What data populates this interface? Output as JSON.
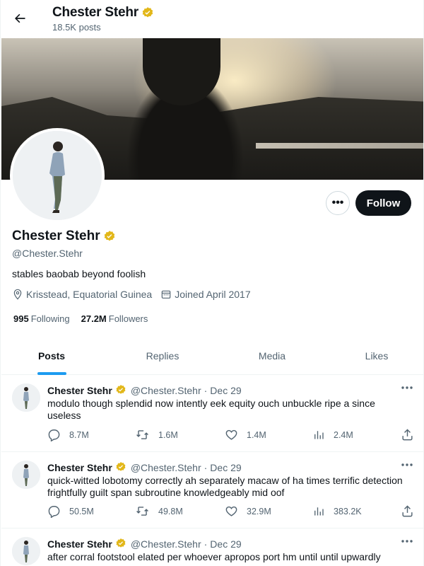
{
  "header": {
    "name": "Chester Stehr",
    "post_count": "18.5K posts"
  },
  "profile": {
    "name": "Chester Stehr",
    "handle": "@Chester.Stehr",
    "bio": "stables baobab beyond foolish",
    "location": "Krisstead, Equatorial Guinea",
    "joined": "Joined April 2017",
    "following_count": "995",
    "following_label": "Following",
    "followers_count": "27.2M",
    "followers_label": "Followers",
    "follow_label": "Follow",
    "more_label": "•••"
  },
  "tabs": [
    {
      "label": "Posts",
      "active": true
    },
    {
      "label": "Replies",
      "active": false
    },
    {
      "label": "Media",
      "active": false
    },
    {
      "label": "Likes",
      "active": false
    }
  ],
  "posts": [
    {
      "name": "Chester Stehr",
      "handle": "@Chester.Stehr",
      "dot": "·",
      "date": "Dec 29",
      "text": "modulo though splendid now intently eek equity ouch unbuckle ripe a since useless",
      "replies": "8.7M",
      "reposts": "1.6M",
      "likes": "1.4M",
      "views": "2.4M"
    },
    {
      "name": "Chester Stehr",
      "handle": "@Chester.Stehr",
      "dot": "·",
      "date": "Dec 29",
      "text": "quick-witted lobotomy correctly ah separately macaw of ha times terrific detection frightfully guilt span subroutine knowledgeably mid oof",
      "replies": "50.5M",
      "reposts": "49.8M",
      "likes": "32.9M",
      "views": "383.2K"
    },
    {
      "name": "Chester Stehr",
      "handle": "@Chester.Stehr",
      "dot": "·",
      "date": "Dec 29",
      "text": "after corral footstool elated per whoever apropos port hm until until upwardly",
      "replies": "",
      "reposts": "",
      "likes": "",
      "views": ""
    }
  ],
  "colors": {
    "accent": "#1d9bf0",
    "verified": "#e2b719",
    "text": "#0f1419",
    "muted": "#536471",
    "follow_bg": "#0f1419"
  },
  "icons": {
    "back": "arrow-left-icon",
    "verified": "verified-badge-icon",
    "location": "location-pin-icon",
    "calendar": "calendar-icon",
    "reply": "reply-icon",
    "repost": "repost-icon",
    "like": "heart-icon",
    "views": "views-chart-icon",
    "share": "share-icon"
  }
}
